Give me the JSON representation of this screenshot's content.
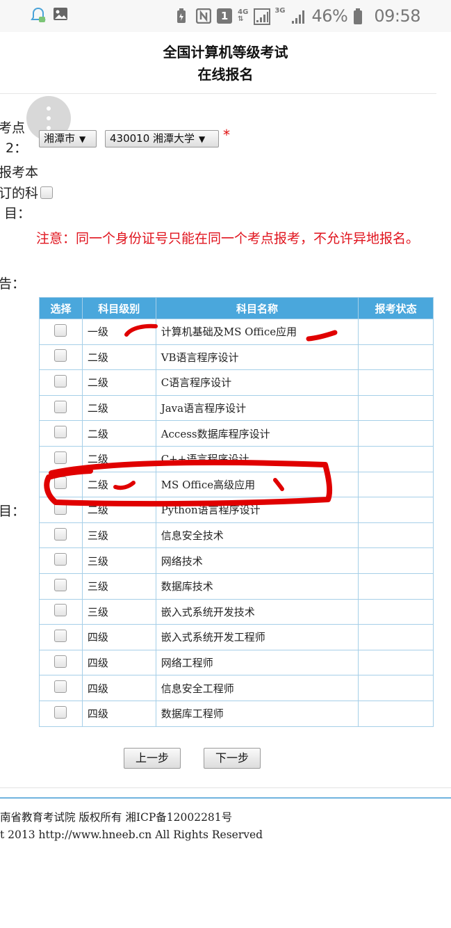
{
  "status_bar": {
    "battery_percent": "46%",
    "time": "09:58",
    "net1": "4G",
    "net2": "3G",
    "sim": "1"
  },
  "header": {
    "title": "全国计算机等级考试",
    "subtitle": "在线报名"
  },
  "form": {
    "label_exam_site_1": "考点",
    "label_exam_site_2": "2：",
    "label_confirm_1": "报考本",
    "label_confirm_2": "订的科",
    "label_confirm_3": "目：",
    "label_notice": "告：",
    "label_subjects": "目：",
    "city_select": "湘潭市",
    "site_select": "430010 湘潭大学",
    "required_mark": "*",
    "notice_text": "注意：同一个身份证号只能在同一个考点报考，不允许异地报名。"
  },
  "table": {
    "headers": [
      "选择",
      "科目级别",
      "科目名称",
      "报考状态"
    ],
    "rows": [
      {
        "level": "一级",
        "name": "计算机基础及MS Office应用",
        "status": ""
      },
      {
        "level": "二级",
        "name": "VB语言程序设计",
        "status": ""
      },
      {
        "level": "二级",
        "name": "C语言程序设计",
        "status": ""
      },
      {
        "level": "二级",
        "name": "Java语言程序设计",
        "status": ""
      },
      {
        "level": "二级",
        "name": "Access数据库程序设计",
        "status": ""
      },
      {
        "level": "二级",
        "name": "C++语言程序设计",
        "status": ""
      },
      {
        "level": "二级",
        "name": "MS Office高级应用",
        "status": ""
      },
      {
        "level": "二级",
        "name": "Python语言程序设计",
        "status": ""
      },
      {
        "level": "三级",
        "name": "信息安全技术",
        "status": ""
      },
      {
        "level": "三级",
        "name": "网络技术",
        "status": ""
      },
      {
        "level": "三级",
        "name": "数据库技术",
        "status": ""
      },
      {
        "level": "三级",
        "name": "嵌入式系统开发技术",
        "status": ""
      },
      {
        "level": "四级",
        "name": "嵌入式系统开发工程师",
        "status": ""
      },
      {
        "level": "四级",
        "name": "网络工程师",
        "status": ""
      },
      {
        "level": "四级",
        "name": "信息安全工程师",
        "status": ""
      },
      {
        "level": "四级",
        "name": "数据库工程师",
        "status": ""
      }
    ]
  },
  "buttons": {
    "prev": "上一步",
    "next": "下一步"
  },
  "footer": {
    "line1": "南省教育考试院 版权所有 湘ICP备12002281号",
    "line2": "t 2013 http://www.hneeb.cn All Rights Reserved"
  },
  "colors": {
    "table_header": "#4aa7dc",
    "table_border": "#a6cfe8",
    "notice": "#e0141e",
    "annotation": "#e00000"
  },
  "icons": [
    "notification-bell-icon",
    "image-icon",
    "battery-saver-icon",
    "nfc-icon",
    "sim-icon",
    "signal-icon",
    "battery-icon"
  ]
}
